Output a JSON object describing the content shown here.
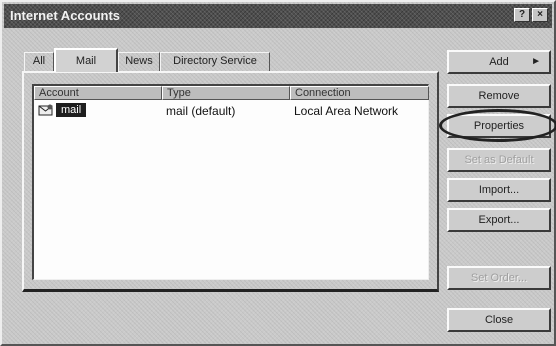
{
  "window": {
    "title": "Internet Accounts",
    "help_glyph": "?",
    "close_glyph": "×"
  },
  "tabs": [
    {
      "label": "All",
      "selected": false
    },
    {
      "label": "Mail",
      "selected": true
    },
    {
      "label": "News",
      "selected": false
    },
    {
      "label": "Directory Service",
      "selected": false
    }
  ],
  "list": {
    "columns": [
      "Account",
      "Type",
      "Connection"
    ],
    "rows": [
      {
        "account": "mail",
        "type": "mail (default)",
        "connection": "Local Area Network",
        "selected": true,
        "icon": "mail-account-icon"
      }
    ]
  },
  "buttons": {
    "add": {
      "label": "Add",
      "glyph": "►",
      "enabled": true
    },
    "remove": {
      "label": "Remove",
      "enabled": true
    },
    "properties": {
      "label": "Properties",
      "enabled": true
    },
    "set_default": {
      "label": "Set as Default",
      "enabled": false
    },
    "import": {
      "label": "Import...",
      "enabled": true
    },
    "export": {
      "label": "Export...",
      "enabled": true
    },
    "set_order": {
      "label": "Set Order...",
      "enabled": false
    },
    "close": {
      "label": "Close",
      "enabled": true
    }
  }
}
